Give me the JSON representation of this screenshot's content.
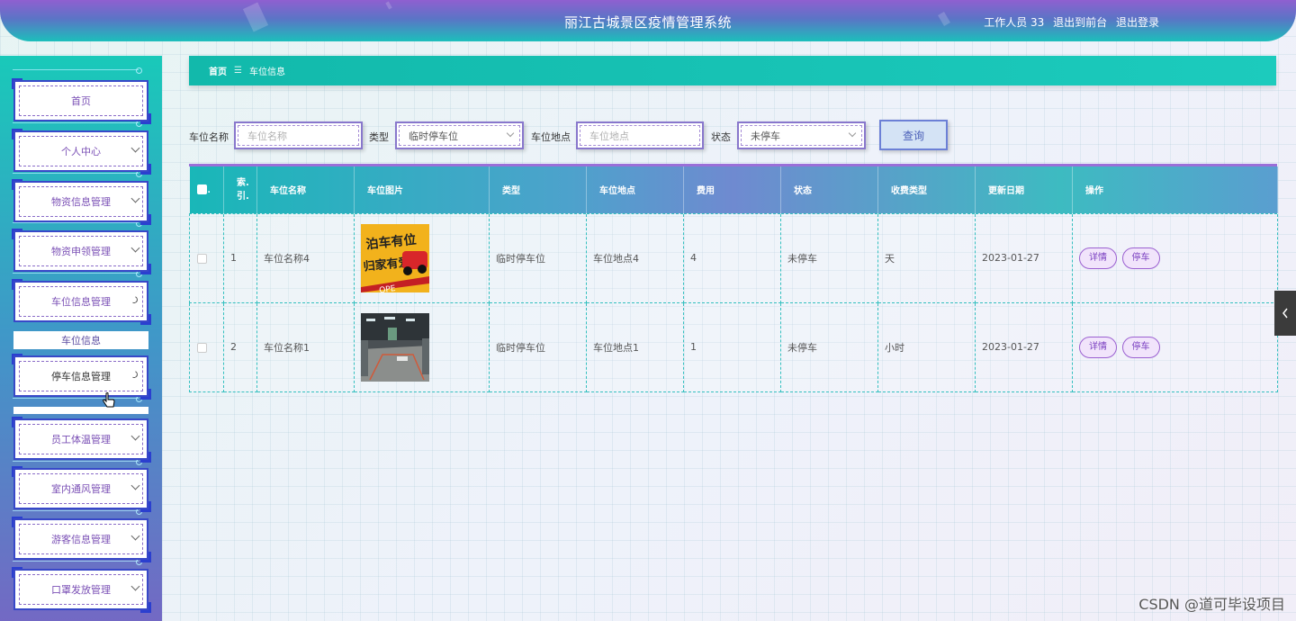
{
  "header": {
    "title": "丽江古城景区疫情管理系统",
    "user": "工作人员 33",
    "to_front": "退出到前台",
    "logout": "退出登录"
  },
  "sidebar": {
    "items": [
      {
        "label": "首页",
        "icon": "none"
      },
      {
        "label": "个人中心",
        "icon": "chevron-down-icon"
      },
      {
        "label": "物资信息管理",
        "icon": "chevron-down-icon"
      },
      {
        "label": "物资申领管理",
        "icon": "chevron-down-icon"
      },
      {
        "label": "车位信息管理",
        "icon": "spinner-icon"
      },
      {
        "label": "车位信息",
        "icon": "none"
      },
      {
        "label": "停车信息管理",
        "icon": "spinner-icon"
      },
      {
        "label": "员工体温管理",
        "icon": "chevron-down-icon"
      },
      {
        "label": "室内通风管理",
        "icon": "chevron-down-icon"
      },
      {
        "label": "游客信息管理",
        "icon": "chevron-down-icon"
      },
      {
        "label": "口罩发放管理",
        "icon": "chevron-down-icon"
      }
    ]
  },
  "breadcrumb": {
    "home": "首页",
    "separator": "☰",
    "current": "车位信息"
  },
  "search": {
    "name_label": "车位名称",
    "name_placeholder": "车位名称",
    "type_label": "类型",
    "type_value": "临时停车位",
    "location_label": "车位地点",
    "location_placeholder": "车位地点",
    "status_label": "状态",
    "status_value": "未停车",
    "query_button": "查询"
  },
  "table": {
    "headers": [
      "索引",
      "车位名称",
      "车位图片",
      "类型",
      "车位地点",
      "费用",
      "状态",
      "收费类型",
      "更新日期",
      "操作"
    ],
    "index_header_top": "索.",
    "index_header_bottom": "引.",
    "rows": [
      {
        "index": "1",
        "name": "车位名称4",
        "image": "parking-sign-image",
        "type": "临时停车位",
        "location": "车位地点4",
        "fee": "4",
        "status": "未停车",
        "charge_type": "天",
        "updated": "2023-01-27",
        "detail": "详情",
        "park": "停车"
      },
      {
        "index": "2",
        "name": "车位名称1",
        "image": "garage-photo-image",
        "type": "临时停车位",
        "location": "车位地点1",
        "fee": "1",
        "status": "未停车",
        "charge_type": "小时",
        "updated": "2023-01-27",
        "detail": "详情",
        "park": "停车"
      }
    ]
  },
  "watermark": "CSDN @道可毕设项目",
  "colors": {
    "accent_teal": "#1cbfbb",
    "accent_purple": "#8f5fd0",
    "button_purple": "#9a5fd0"
  }
}
